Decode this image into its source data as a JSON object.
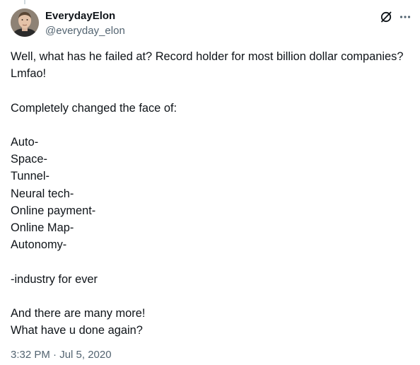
{
  "tweet": {
    "author_name": "EverydayElon",
    "author_handle": "@everyday_elon",
    "text": "Well, what has he failed at? Record holder for most billion dollar companies? Lmfao!\n\nCompletely changed the face of:\n\nAuto-\nSpace-\nTunnel-\nNeural tech-\nOnline payment-\nOnline Map-\nAutonomy-\n\n-industry for ever\n\nAnd there are many more!\nWhat have u done again?",
    "timestamp": "3:32 PM · Jul 5, 2020"
  },
  "icons": {
    "grok": "grok-slash-circle-icon",
    "more": "more-horizontal-icon"
  },
  "colors": {
    "text": "#0f1419",
    "secondary": "#536471",
    "thread_line": "#cfd9de"
  }
}
